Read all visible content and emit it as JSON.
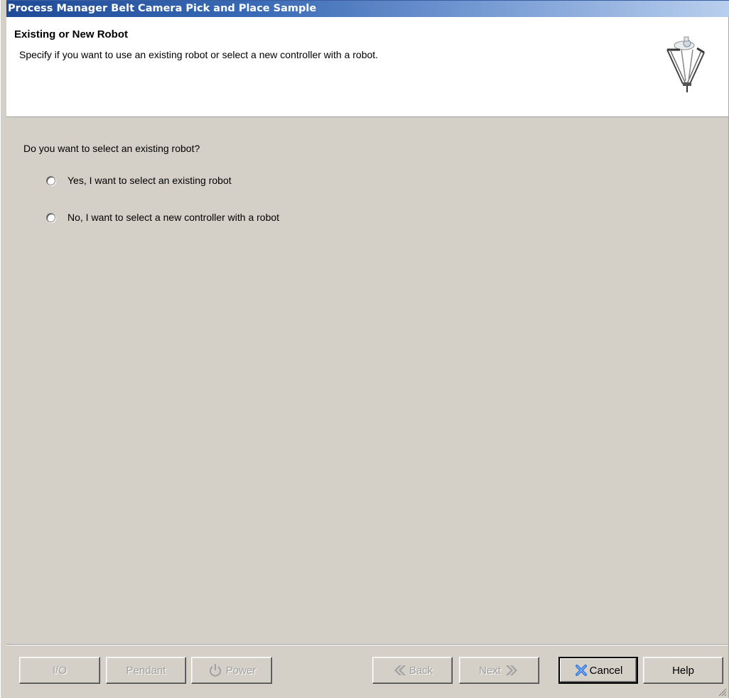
{
  "window": {
    "title": "Process Manager Belt Camera Pick and Place Sample"
  },
  "header": {
    "title": "Existing or New Robot",
    "description": "Specify if you want to use an existing robot or select a new controller with a robot.",
    "icon": "delta-robot-icon"
  },
  "content": {
    "question": "Do you want to select an existing robot?",
    "options": [
      {
        "label": "Yes, I want to select an existing robot",
        "selected": false
      },
      {
        "label": "No, I want to select a new controller with a robot",
        "selected": false
      }
    ]
  },
  "footer": {
    "io_label": "I/O",
    "pendant_label": "Pendant",
    "power_label": "Power",
    "back_label": "Back",
    "next_label": "Next",
    "cancel_label": "Cancel",
    "help_label": "Help"
  },
  "colors": {
    "title_gradient_start": "#1e4a96",
    "title_gradient_end": "#b9cfee",
    "dialog_background": "#d4d0c8",
    "cancel_icon": "#2a6fd6"
  }
}
